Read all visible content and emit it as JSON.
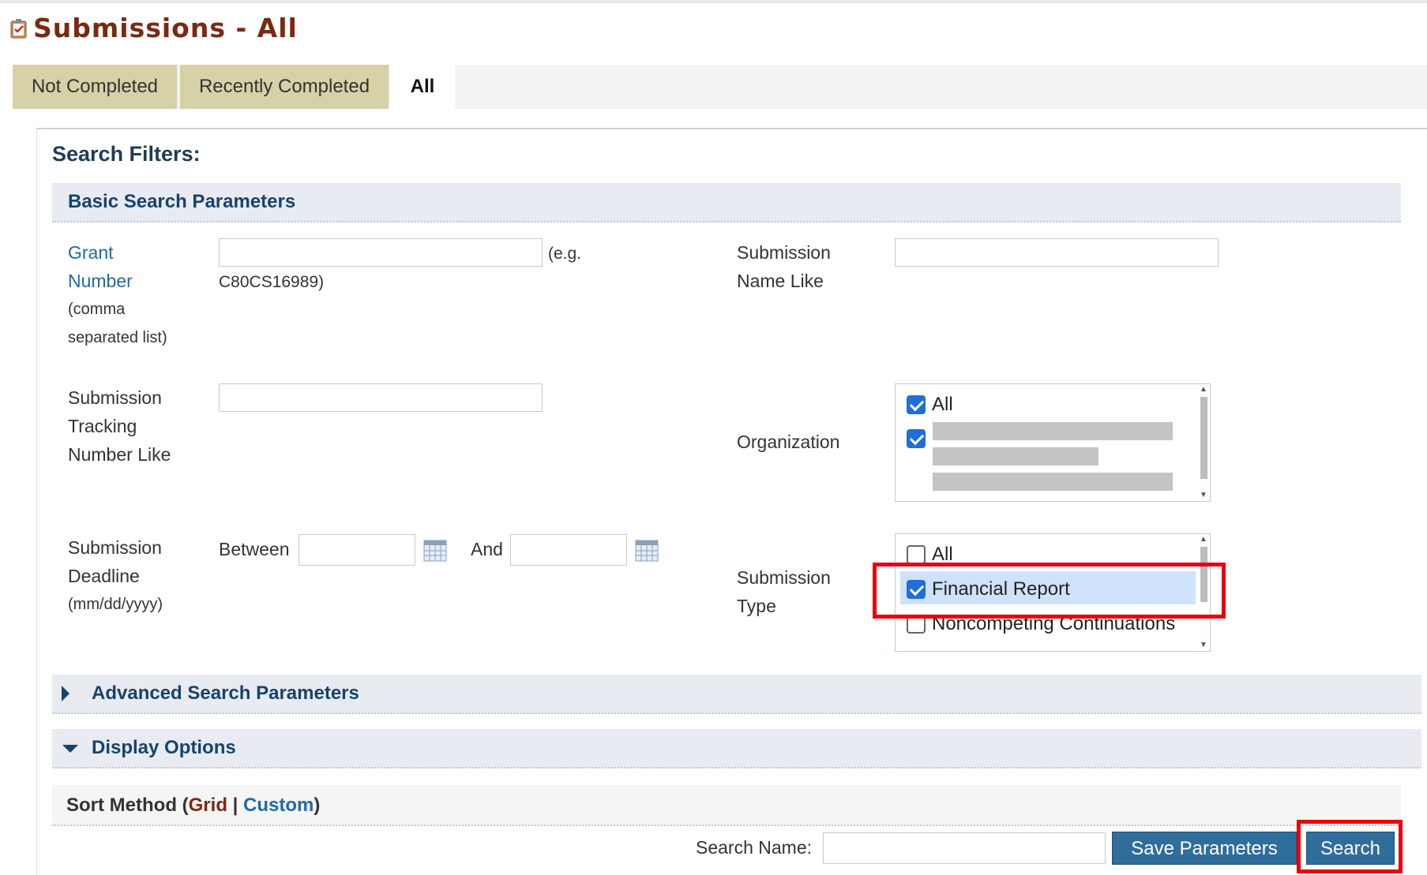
{
  "page": {
    "title": "Submissions - All"
  },
  "tabs": [
    {
      "label": "Not Completed"
    },
    {
      "label": "Recently Completed"
    },
    {
      "label": "All"
    }
  ],
  "filters": {
    "heading": "Search Filters:",
    "basic_section": "Basic Search Parameters",
    "grant_number": {
      "label_link1": "Grant",
      "label_link2": "Number",
      "label_note1": "(comma",
      "label_note2": "separated list)",
      "value": "",
      "hint1": "(e.g.",
      "hint2": "C80CS16989)"
    },
    "submission_name": {
      "label1": "Submission",
      "label2": "Name Like",
      "value": ""
    },
    "tracking_number": {
      "label1": "Submission",
      "label2": "Tracking",
      "label3": "Number Like",
      "value": ""
    },
    "organization": {
      "label": "Organization",
      "options": [
        {
          "label": "All",
          "checked": true
        },
        {
          "label": "",
          "checked": true
        }
      ]
    },
    "deadline": {
      "label1": "Submission",
      "label2": "Deadline",
      "label3": "(mm/dd/yyyy)",
      "between": "Between",
      "and": "And",
      "from": "",
      "to": ""
    },
    "submission_type": {
      "label1": "Submission",
      "label2": "Type",
      "options": [
        {
          "label": "All",
          "checked": false
        },
        {
          "label": "Financial Report",
          "checked": true
        },
        {
          "label": "Noncompeting Continuations",
          "checked": false
        }
      ]
    },
    "advanced_section": "Advanced Search Parameters",
    "display_section": "Display Options",
    "sort": {
      "prefix": "Sort Method (",
      "grid": "Grid",
      "sep": " | ",
      "custom": "Custom",
      "suffix": ")"
    },
    "search_name": {
      "label": "Search Name:",
      "value": ""
    },
    "save_button": "Save Parameters",
    "search_button": "Search"
  },
  "colors": {
    "accent": "#2f6d9a",
    "title": "#7a2a12",
    "highlight": "#e8000b",
    "tab": "#d6d1a6"
  }
}
